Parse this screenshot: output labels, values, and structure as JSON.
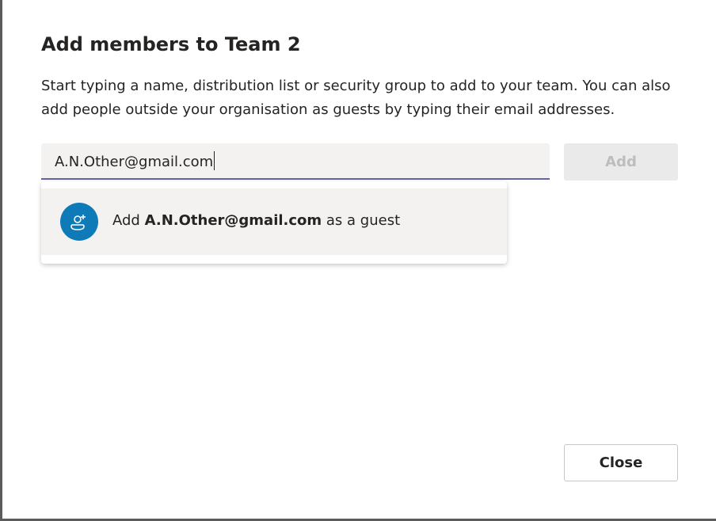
{
  "dialog": {
    "title": "Add members to Team 2",
    "description": "Start typing a name, distribution list or security group to add to your team. You can also add people outside your organisation as guests by typing their email addresses."
  },
  "search": {
    "value": "A.N.Other@gmail.com"
  },
  "add_button": {
    "label": "Add",
    "enabled": false
  },
  "suggestion": {
    "prefix": "Add",
    "email": "A.N.Other@gmail.com",
    "suffix": "as a guest",
    "icon": "add-guest-icon"
  },
  "close_button": {
    "label": "Close"
  },
  "colors": {
    "accent": "#6264a7",
    "avatar": "#0e7bb8"
  }
}
